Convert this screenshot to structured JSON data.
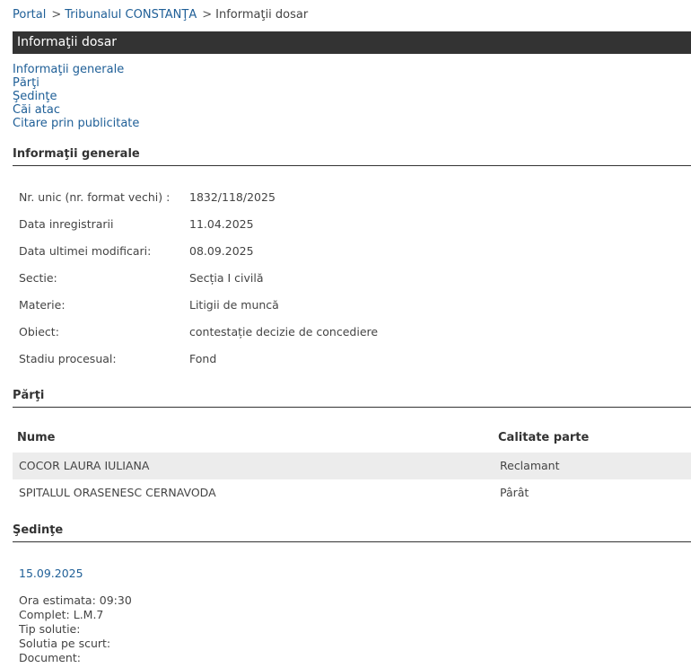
{
  "breadcrumb": {
    "portal": "Portal",
    "court": "Tribunalul CONSTANŢA",
    "current": "Informaţii dosar",
    "separator": ">"
  },
  "title": "Informaţii dosar",
  "nav": [
    "Informaţii generale",
    "Părţi",
    "Şedinţe",
    "Căi atac",
    "Citare prin publicitate"
  ],
  "general": {
    "heading": "Informaţii generale",
    "rows": [
      {
        "label": "Nr. unic (nr. format vechi) :",
        "value": "1832/118/2025"
      },
      {
        "label": "Data inregistrarii",
        "value": "11.04.2025"
      },
      {
        "label": "Data ultimei modificari:",
        "value": "08.09.2025"
      },
      {
        "label": "Sectie:",
        "value": "Secția I civilă"
      },
      {
        "label": "Materie:",
        "value": "Litigii de muncă"
      },
      {
        "label": "Obiect:",
        "value": "contestație decizie de concediere"
      },
      {
        "label": "Stadiu procesual:",
        "value": "Fond"
      }
    ]
  },
  "parties": {
    "heading": "Părţi",
    "col_name": "Nume",
    "col_role": "Calitate parte",
    "rows": [
      {
        "name": "COCOR LAURA IULIANA",
        "role": "Reclamant"
      },
      {
        "name": "SPITALUL ORASENESC CERNAVODA",
        "role": "Pârât"
      }
    ]
  },
  "hearings": {
    "heading": "Şedinţe",
    "date": "15.09.2025",
    "lines": [
      "Ora estimata: 09:30",
      "Complet: L.M.7",
      "Tip solutie:",
      "Solutia pe scurt:",
      "Document:"
    ]
  },
  "colors": {
    "link": "#1f5f97",
    "titlebar": "#333333",
    "row_alt": "#ececec"
  }
}
